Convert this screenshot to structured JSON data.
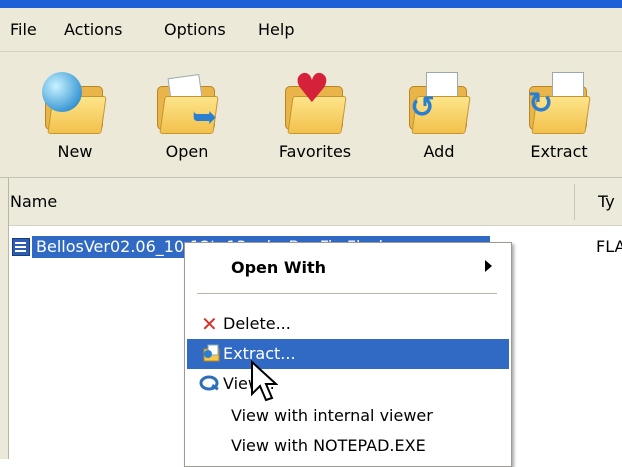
{
  "menubar": {
    "items": [
      "File",
      "Actions",
      "Options",
      "Help"
    ]
  },
  "toolbar": {
    "buttons": [
      {
        "label": "New",
        "icon": "new-folder-globe-icon"
      },
      {
        "label": "Open",
        "icon": "open-folder-icon"
      },
      {
        "label": "Favorites",
        "icon": "favorites-heart-folder-icon"
      },
      {
        "label": "Add",
        "icon": "add-folder-icon"
      },
      {
        "label": "Extract",
        "icon": "extract-folder-icon"
      }
    ]
  },
  "file_list": {
    "columns": {
      "name": "Name",
      "type": "Ty"
    },
    "rows": [
      {
        "name": "BellosVer02.06_10-12to13only_BugFix.Flash",
        "type": "FLA"
      }
    ]
  },
  "context_menu": {
    "open_with": "Open With",
    "delete": "Delete...",
    "extract": "Extract...",
    "view": "View...",
    "view_internal": "View with internal viewer",
    "view_notepad": "View with NOTEPAD.EXE"
  },
  "colors": {
    "selection": "#316ac5",
    "menu_bg": "#ece9d8",
    "title_blue": "#1c5fd6"
  }
}
